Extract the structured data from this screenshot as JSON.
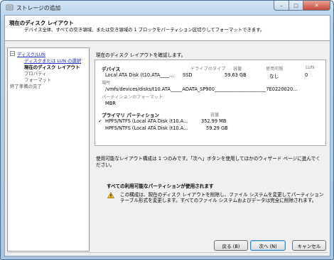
{
  "window": {
    "title": "ストレージの追加",
    "min_glyph": "–",
    "max_glyph": "□",
    "close_glyph": "✕"
  },
  "header": {
    "title": "現在のディスク レイアウト",
    "description": "デバイス全体、すべての空き領域、または空き領域の 1 ブロックをパーティション区切りしてフォーマットできます。"
  },
  "nav": {
    "toggle": "−",
    "items": [
      {
        "label": "ディスク/LUN",
        "state": "link"
      },
      {
        "label": "ディスクまたは LUN の選択",
        "state": "link"
      },
      {
        "label": "現在のディスク レイアウト",
        "state": "current"
      },
      {
        "label": "プロパティ",
        "state": "disabled"
      },
      {
        "label": "フォーマット",
        "state": "disabled"
      },
      {
        "label": "終了準備の完了",
        "state": "disabled"
      }
    ]
  },
  "main": {
    "intro": "現在のディスク レイアウトを確認します。",
    "device": {
      "heading": "デバイス",
      "col_drive_type": "ドライブのタイプ",
      "col_capacity": "容量",
      "col_available": "使用可能",
      "col_lun": "LUN",
      "name": "Local ATA Disk (t10.ATA____...",
      "drive_type": "SSD",
      "capacity": "59.63 GB",
      "available": "なし",
      "lun": "0",
      "location_label": "場所",
      "location": "/vmfs/devices/disks/t10.ATA_____ADATA_SP900______________________7E0220020...",
      "partition_format_label": "パーティションのフォーマット",
      "partition_format": "MBR"
    },
    "primary": {
      "heading": "プライマリ パーティション",
      "col_capacity": "容量",
      "check_glyph": "✓",
      "rows": [
        {
          "name": "HPFS/NTFS (Local ATA Disk (t10.A...",
          "capacity": "352.99 MB",
          "checked": true
        },
        {
          "name": "HPFS/NTFS (Local ATA Disk (t10.A...",
          "capacity": "59.29 GB",
          "checked": false
        }
      ]
    },
    "note": "使用可能なレイアウト構成は 1 つのみです。「次へ」ボタンを使用してほかのウィザード ページに進んでください。",
    "warning": {
      "title": "すべての利用可能なパーティションが使用されます",
      "text": "この構成は、現在のディスク レイアウトを削除し、ファイル システムを変更してパーティション テーブル形式を変更します。すべてのファイル システムおよびデータは完全に削除されます。"
    }
  },
  "footer": {
    "back": "戻る (B)",
    "next": "次へ (N)",
    "cancel": "キャンセル"
  },
  "colors": {
    "warning": "#f2c21b",
    "link": "#2030c0"
  }
}
